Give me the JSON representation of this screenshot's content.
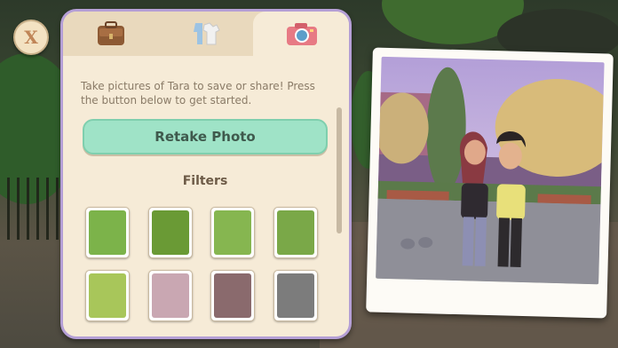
{
  "close_button": {
    "label": "X"
  },
  "tabs": [
    {
      "name": "wardrobe",
      "icon": "backpack-icon"
    },
    {
      "name": "outfits",
      "icon": "clothes-icon"
    },
    {
      "name": "camera",
      "icon": "camera-icon",
      "active": true
    }
  ],
  "camera_panel": {
    "description": "Take pictures of Tara to save or share! Press the button below to get started.",
    "retake_label": "Retake Photo",
    "filters_title": "Filters",
    "filters": [
      {
        "id": 1,
        "tint": "#7cb34a"
      },
      {
        "id": 2,
        "tint": "#6a9a35"
      },
      {
        "id": 3,
        "tint": "#86b650"
      },
      {
        "id": 4,
        "tint": "#7aa848"
      },
      {
        "id": 5,
        "tint": "#a8c65a"
      },
      {
        "id": 6,
        "tint": "#c9a7b2"
      },
      {
        "id": 7,
        "tint": "#8a6a6d"
      },
      {
        "id": 8,
        "tint": "#7c7c7c"
      }
    ]
  },
  "colors": {
    "panel_bg": "#f6ebd7",
    "panel_border": "#b59fd6",
    "button_bg": "#9fe3c7"
  }
}
